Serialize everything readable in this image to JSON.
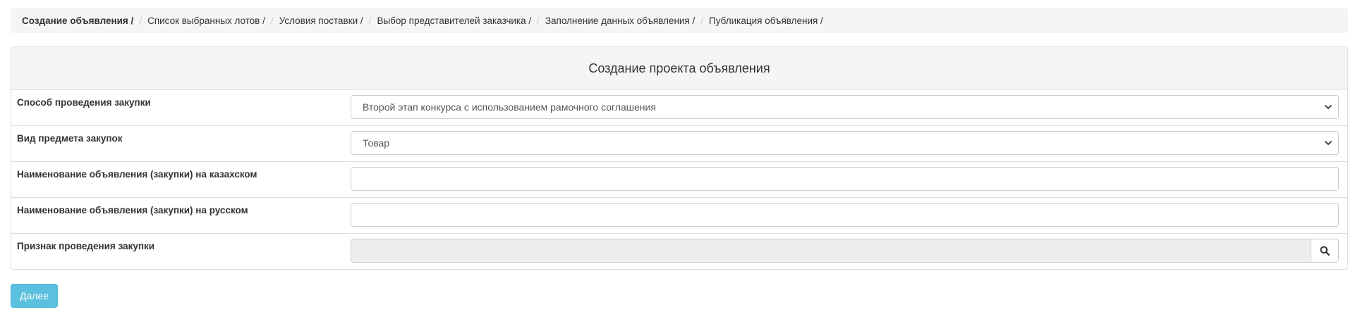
{
  "breadcrumb": {
    "items": [
      "Создание объявления /",
      "Список выбранных лотов /",
      "Условия поставки /",
      "Выбор представителей заказчика /",
      "Заполнение данных объявления /",
      "Публикация объявления /"
    ],
    "separator": "/",
    "active_index": 0
  },
  "panel": {
    "title": "Создание проекта объявления",
    "rows": [
      {
        "label": "Способ проведения закупки",
        "type": "select",
        "value": "Второй этап конкурса с использованием рамочного соглашения"
      },
      {
        "label": "Вид предмета закупок",
        "type": "select",
        "value": "Товар"
      },
      {
        "label": "Наименование объявления (закупки) на казахском",
        "type": "text",
        "value": ""
      },
      {
        "label": "Наименование объявления (закупки) на русском",
        "type": "text",
        "value": ""
      },
      {
        "label": "Признак проведения закупки",
        "type": "lookup",
        "value": "",
        "button_icon": "search-icon"
      }
    ]
  },
  "actions": {
    "next_label": "Далее"
  },
  "colors": {
    "accent": "#5bc0de",
    "panel_heading_bg": "#f5f5f5",
    "readonly_bg": "#eeeeee"
  }
}
